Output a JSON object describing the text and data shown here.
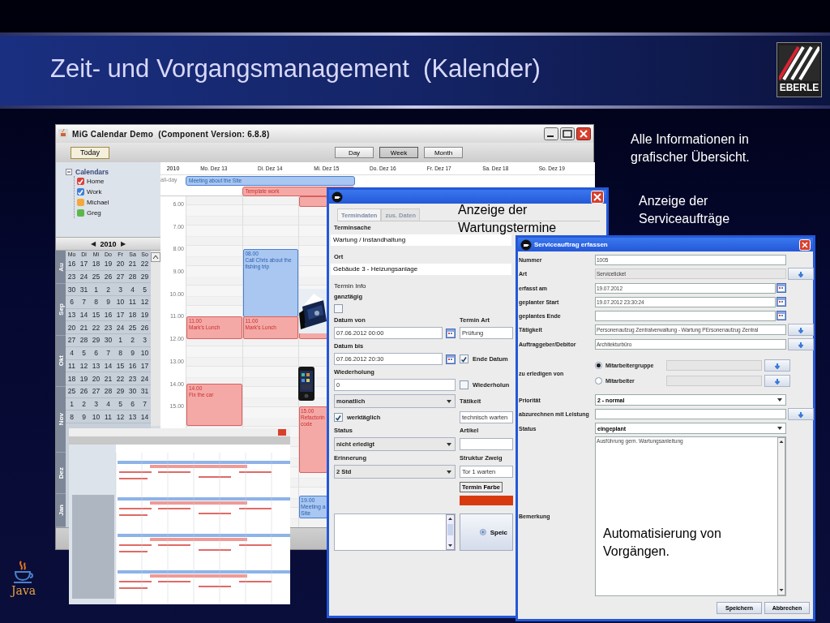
{
  "slide": {
    "title": "Zeit- und Vorgangsmanagement  (Kalender)",
    "logo_text": "EBERLE",
    "java_text": "Java",
    "callouts": [
      "Alle Informationen in grafischer Übersicht.",
      "Anzeige der Serviceaufträge",
      "Anzeige der Wartungstermine",
      "Automatisierung von Vorgängen."
    ]
  },
  "calendar_window": {
    "title": "MiG Calendar Demo  (Component Version: 6.8.8)",
    "today": "Today",
    "views": [
      {
        "label": "Day",
        "selected": false
      },
      {
        "label": "Week",
        "selected": true
      },
      {
        "label": "Month",
        "selected": false
      }
    ],
    "calendars": {
      "label": "Calendars",
      "expanded": true,
      "items": [
        {
          "name": "Home",
          "color": "#d9413a",
          "checked": true
        },
        {
          "name": "Work",
          "color": "#3d7fd6",
          "checked": true
        },
        {
          "name": "Michael",
          "color": "#f2a93b",
          "checked": false
        },
        {
          "name": "Greg",
          "color": "#5cb84a",
          "checked": false
        }
      ]
    },
    "mini_calendar": {
      "prev": "◀",
      "year": "2010",
      "next": "▶",
      "weekdays": [
        "Mo",
        "Di",
        "Mi",
        "Do",
        "Fr",
        "Sa",
        "So"
      ],
      "months": [
        "Au",
        "Sep",
        "Okt",
        "Nov",
        "Dez",
        "Jan"
      ],
      "weeks": [
        [
          "16",
          "17",
          "18",
          "19",
          "20",
          "21",
          "22"
        ],
        [
          "23",
          "24",
          "25",
          "26",
          "27",
          "28",
          "29"
        ],
        [
          "30",
          "31",
          "1",
          "2",
          "3",
          "4",
          "5"
        ],
        [
          "6",
          "7",
          "8",
          "9",
          "10",
          "11",
          "12"
        ],
        [
          "13",
          "14",
          "15",
          "16",
          "17",
          "18",
          "19"
        ],
        [
          "20",
          "21",
          "22",
          "23",
          "24",
          "25",
          "26"
        ],
        [
          "27",
          "28",
          "29",
          "30",
          "1",
          "2",
          "3"
        ],
        [
          "4",
          "5",
          "6",
          "7",
          "8",
          "9",
          "10"
        ],
        [
          "11",
          "12",
          "13",
          "14",
          "15",
          "16",
          "17"
        ],
        [
          "18",
          "19",
          "20",
          "21",
          "22",
          "23",
          "24"
        ],
        [
          "25",
          "26",
          "27",
          "28",
          "29",
          "30",
          "31"
        ],
        [
          "1",
          "2",
          "3",
          "4",
          "5",
          "6",
          "7"
        ],
        [
          "8",
          "9",
          "10",
          "11",
          "12",
          "13",
          "14"
        ]
      ]
    },
    "week_view": {
      "year": "2010",
      "days": [
        "Mo. Dez 13",
        "Di. Dez 14",
        "Mi. Dez 15",
        "Do. Dez 16",
        "Fr. Dez 17",
        "Sa. Dez 18",
        "So. Dez 19"
      ],
      "allday_label": "all-day",
      "allday_events": [
        {
          "title": "Meeting about the Site",
          "color": "#a9c7f0"
        },
        {
          "title": "Template work",
          "color": "#f4a9a6"
        }
      ],
      "times": [
        "6.00",
        "7.00",
        "8.00",
        "9.00",
        "10.00",
        "11.00",
        "12.00",
        "13.00",
        "14.00",
        "15.00"
      ],
      "columns": [
        {
          "events": [
            {
              "time": "11.00",
              "title": "Mark's Lunch",
              "color": "#f4a9a6"
            },
            {
              "time": "14.00",
              "title": "Fix the car",
              "color": "#f4a9a6"
            }
          ]
        },
        {
          "events": [
            {
              "time": "08.00",
              "title": "Call Chris about the fishing trip",
              "color": "#a9c7f0"
            },
            {
              "time": "11.00",
              "title": "Mark's Lunch",
              "color": "#f4a9a6"
            }
          ]
        },
        {
          "events": [
            {
              "color": "#f4a9a6"
            },
            {
              "color": "#f4a9a6"
            },
            {
              "time": "15.00",
              "title": "Refactorin code",
              "color": "#f4a9a6"
            },
            {
              "time": "19.00",
              "title": "Meeting a Site",
              "color": "#a9c7f0"
            }
          ]
        }
      ]
    }
  },
  "appointment_dialog": {
    "tabs": [
      {
        "label": "Termindaten",
        "selected": true
      },
      {
        "label": "zus. Daten",
        "selected": false
      }
    ],
    "rows": [
      {
        "left": {
          "kind": "label",
          "text": "Terminsache"
        }
      },
      {
        "left": {
          "kind": "wide",
          "value": "Wartung / Instandhaltung"
        }
      },
      {
        "left": {
          "kind": "label",
          "text": "Ort"
        }
      },
      {
        "left": {
          "kind": "wide",
          "value": "Gebäude 3 - Heizungsanlage"
        }
      },
      {
        "left": {
          "kind": "plain",
          "text": "Termin Info"
        }
      },
      {
        "left": {
          "kind": "label",
          "text": "ganztägig"
        }
      },
      {
        "left": {
          "kind": "checkbox",
          "checked": false
        }
      },
      {
        "left": {
          "kind": "label",
          "text": "Datum von"
        },
        "right": {
          "kind": "label",
          "text": "Termin Art"
        }
      },
      {
        "left": {
          "kind": "date",
          "value": "07.06.2012 00:00"
        },
        "right": {
          "kind": "field",
          "value": "Prüfung"
        }
      },
      {
        "left": {
          "kind": "label",
          "text": "Datum bis"
        }
      },
      {
        "left": {
          "kind": "date",
          "value": "07.06.2012 20:30"
        },
        "right": {
          "kind": "checkbox",
          "checked": true,
          "text": "Ende Datum"
        }
      },
      {
        "left": {
          "kind": "label",
          "text": "Wiederholung"
        }
      },
      {
        "left": {
          "kind": "field",
          "value": "0"
        },
        "right": {
          "kind": "checkbox",
          "checked": false,
          "text": "Wiederholun"
        }
      },
      {
        "left": {
          "kind": "dropdown",
          "value": "monatlich"
        },
        "right": {
          "kind": "label",
          "text": "Tätikeit"
        }
      },
      {
        "left": {
          "kind": "checkbox",
          "checked": true,
          "text": "werktäglich"
        },
        "right": {
          "kind": "field",
          "value": "technisch warten"
        }
      },
      {
        "left": {
          "kind": "label",
          "text": "Status"
        },
        "right": {
          "kind": "label",
          "text": "Artikel"
        }
      },
      {
        "left": {
          "kind": "dropdown",
          "value": "nicht erledigt"
        },
        "right": {
          "kind": "field"
        }
      },
      {
        "left": {
          "kind": "label",
          "text": "Erinnerung"
        },
        "right": {
          "kind": "label",
          "text": "Struktur Zweig"
        }
      },
      {
        "left": {
          "kind": "dropdown",
          "value": "2 Std"
        },
        "right": {
          "kind": "field",
          "value": "Tor 1 warten"
        }
      },
      {
        "right": {
          "kind": "button",
          "text": "Termin Farbe"
        }
      },
      {
        "right": {
          "kind": "swatch",
          "color": "#d83a10"
        }
      },
      {
        "left": {
          "kind": "textarea"
        },
        "right": {
          "kind": "save",
          "text": "Speic"
        }
      }
    ]
  },
  "service_dialog": {
    "title": "Serviceauftrag erfassen",
    "rows": [
      {
        "label": "Nummer",
        "kind": "field",
        "value": "1005"
      },
      {
        "label": "Art",
        "kind": "readonly",
        "value": "Serviceticket",
        "picker": true
      },
      {
        "label": "erfasst am",
        "kind": "date",
        "value": "19.07.2012"
      },
      {
        "label": "geplanter Start",
        "kind": "date",
        "value": "19.07.2012 23:30:24"
      },
      {
        "label": "geplantes Ende",
        "kind": "date"
      },
      {
        "label": "Tätigkeit",
        "kind": "field",
        "value": "Personenaufzug Zentralverwaltung - Wartung PErsonenaufzug Zentral",
        "picker": true
      },
      {
        "label": "Auftraggeber/Debitor",
        "kind": "field",
        "value": "Architekturbüro",
        "picker": true
      },
      {
        "label": "zu erledigen von",
        "kind": "radios",
        "options": [
          {
            "label": "Mitarbeitergruppe",
            "selected": true
          },
          {
            "label": "Mitarbeiter",
            "selected": false
          }
        ]
      },
      {
        "label": "Priorität",
        "kind": "dropdown",
        "value": "2 - normal"
      },
      {
        "label": "abzurechnen mit Leistung",
        "kind": "field",
        "picker": true
      },
      {
        "label": "Status",
        "kind": "dropdown",
        "value": "eingeplant"
      },
      {
        "label": "Bemerkung",
        "kind": "textarea",
        "value": "Ausführung gem. Wartungsanleitung"
      }
    ],
    "buttons": [
      "Speichern",
      "Abbrechen"
    ]
  }
}
